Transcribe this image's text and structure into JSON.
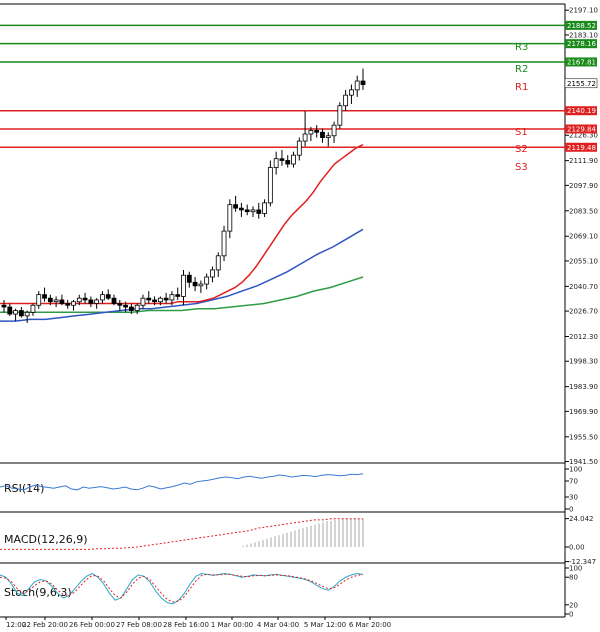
{
  "chart_data": {
    "type": "candlestick",
    "price_ticks": [
      2197.1,
      2183.1,
      2126.3,
      2111.9,
      2097.9,
      2083.5,
      2069.1,
      2055.1,
      2040.7,
      2026.7,
      2012.3,
      1998.3,
      1983.9,
      1969.9,
      1955.5,
      1941.5
    ],
    "price_range": [
      1941.5,
      2203.0
    ],
    "x_labels": [
      "12:00",
      "22 Feb 20:00",
      "26 Feb 00:00",
      "27 Feb 08:00",
      "28 Feb 16:00",
      "1 Mar 00:00",
      "4 Mar 04:00",
      "5 Mar 12:00",
      "6 Mar 20:00"
    ],
    "current_price": 2155.72,
    "levels": [
      {
        "name": "R3",
        "value": 2188.52,
        "value_label": "2188.52",
        "color": "#1a8a1a"
      },
      {
        "name": "",
        "value": 2178.16,
        "value_label": "2178.16",
        "color": "#1a8a1a"
      },
      {
        "name": "R2",
        "value": 2167.81,
        "value_label": "2167.81",
        "color": "#1a8a1a"
      },
      {
        "name": "R1",
        "value": 2140.19,
        "value_label": "2140.19",
        "color": "#e02020"
      },
      {
        "name": "S1",
        "value": 2129.84,
        "value_label": "2129.84",
        "color": "#e02020"
      },
      {
        "name": "S2",
        "value": 2119.48,
        "value_label": "2119.48",
        "color": "#e02020"
      },
      {
        "name": "S3",
        "value": null,
        "value_label": "",
        "color": "#e02020"
      }
    ],
    "candles": [
      [
        2030,
        2033,
        2026,
        2029
      ],
      [
        2029,
        2031,
        2024,
        2025
      ],
      [
        2025,
        2028,
        2021,
        2027
      ],
      [
        2027,
        2029,
        2023,
        2024
      ],
      [
        2024,
        2027,
        2020,
        2026
      ],
      [
        2026,
        2031,
        2024,
        2030
      ],
      [
        2030,
        2038,
        2028,
        2036
      ],
      [
        2036,
        2040,
        2032,
        2034
      ],
      [
        2034,
        2036,
        2030,
        2032
      ],
      [
        2032,
        2035,
        2029,
        2033
      ],
      [
        2033,
        2036,
        2030,
        2031
      ],
      [
        2031,
        2033,
        2028,
        2030
      ],
      [
        2030,
        2033,
        2027,
        2032
      ],
      [
        2032,
        2036,
        2030,
        2034
      ],
      [
        2034,
        2037,
        2031,
        2033
      ],
      [
        2033,
        2035,
        2029,
        2031
      ],
      [
        2031,
        2034,
        2028,
        2033
      ],
      [
        2033,
        2038,
        2031,
        2036
      ],
      [
        2036,
        2039,
        2033,
        2034
      ],
      [
        2034,
        2036,
        2030,
        2031
      ],
      [
        2031,
        2033,
        2027,
        2030
      ],
      [
        2030,
        2032,
        2026,
        2029
      ],
      [
        2029,
        2031,
        2025,
        2027
      ],
      [
        2027,
        2031,
        2025,
        2030
      ],
      [
        2030,
        2036,
        2028,
        2034
      ],
      [
        2034,
        2038,
        2031,
        2033
      ],
      [
        2033,
        2035,
        2030,
        2032
      ],
      [
        2032,
        2035,
        2030,
        2034
      ],
      [
        2034,
        2037,
        2031,
        2033
      ],
      [
        2033,
        2038,
        2030,
        2036
      ],
      [
        2036,
        2040,
        2033,
        2035
      ],
      [
        2035,
        2050,
        2030,
        2047
      ],
      [
        2047,
        2049,
        2040,
        2043
      ],
      [
        2043,
        2046,
        2038,
        2041
      ],
      [
        2041,
        2044,
        2037,
        2042
      ],
      [
        2042,
        2048,
        2039,
        2046
      ],
      [
        2046,
        2052,
        2043,
        2050
      ],
      [
        2050,
        2060,
        2046,
        2058
      ],
      [
        2058,
        2075,
        2055,
        2072
      ],
      [
        2072,
        2090,
        2068,
        2087
      ],
      [
        2087,
        2092,
        2083,
        2085
      ],
      [
        2085,
        2088,
        2080,
        2084
      ],
      [
        2084,
        2087,
        2081,
        2083
      ],
      [
        2083,
        2086,
        2080,
        2084
      ],
      [
        2084,
        2088,
        2079,
        2082
      ],
      [
        2082,
        2090,
        2080,
        2088
      ],
      [
        2088,
        2112,
        2086,
        2108
      ],
      [
        2108,
        2117,
        2104,
        2113
      ],
      [
        2113,
        2118,
        2109,
        2112
      ],
      [
        2112,
        2115,
        2108,
        2110
      ],
      [
        2110,
        2117,
        2108,
        2115
      ],
      [
        2115,
        2125,
        2112,
        2123
      ],
      [
        2123,
        2140,
        2120,
        2127
      ],
      [
        2127,
        2131,
        2123,
        2129
      ],
      [
        2129,
        2132,
        2125,
        2128
      ],
      [
        2128,
        2130,
        2122,
        2125
      ],
      [
        2125,
        2128,
        2120,
        2126
      ],
      [
        2126,
        2134,
        2122,
        2132
      ],
      [
        2132,
        2145,
        2130,
        2143
      ],
      [
        2143,
        2152,
        2140,
        2149
      ],
      [
        2149,
        2155,
        2144,
        2152
      ],
      [
        2152,
        2160,
        2148,
        2157
      ],
      [
        2157,
        2164,
        2152,
        2155
      ]
    ],
    "ma_red": [
      2031,
      2031,
      2031,
      2031,
      2031,
      2031,
      2031,
      2031,
      2031,
      2031,
      2031,
      2031,
      2031,
      2031,
      2031,
      2031,
      2031,
      2031,
      2031,
      2031,
      2031,
      2031,
      2031,
      2031,
      2031,
      2032,
      2032,
      2032,
      2032,
      2033,
      2034,
      2036,
      2038,
      2040,
      2043,
      2047,
      2052,
      2058,
      2064,
      2070,
      2076,
      2081,
      2085,
      2089,
      2094,
      2100,
      2105,
      2110,
      2113,
      2116,
      2119,
      2121
    ],
    "ma_blue": [
      2021,
      2021,
      2022,
      2022,
      2023,
      2024,
      2025,
      2026,
      2027,
      2028,
      2028,
      2029,
      2030,
      2031,
      2033,
      2035,
      2038,
      2041,
      2045,
      2049,
      2054,
      2059,
      2063,
      2068,
      2073
    ],
    "ma_green": [
      2026,
      2026,
      2026,
      2026,
      2026,
      2026,
      2026,
      2026,
      2026,
      2027,
      2027,
      2027,
      2028,
      2028,
      2029,
      2030,
      2031,
      2033,
      2035,
      2038,
      2040,
      2043,
      2046
    ],
    "rsi": {
      "label": "RSI(14)",
      "ticks": [
        100,
        70,
        30,
        0
      ],
      "values": [
        55,
        58,
        52,
        50,
        48,
        55,
        60,
        56,
        54,
        52,
        55,
        58,
        50,
        48,
        55,
        52,
        54,
        56,
        53,
        50,
        52,
        55,
        50,
        48,
        52,
        58,
        55,
        50,
        53,
        56,
        60,
        65,
        62,
        68,
        70,
        72,
        75,
        78,
        80,
        78,
        76,
        80,
        82,
        79,
        77,
        80,
        82,
        85,
        83,
        80,
        82,
        84,
        83,
        81,
        84,
        86,
        85,
        83,
        84,
        87,
        86,
        88
      ]
    },
    "macd": {
      "label": "MACD(12,26,9)",
      "ticks": [
        "24.042",
        "0.00",
        "-12.347"
      ],
      "histogram": [
        0,
        0,
        1,
        2,
        3,
        4,
        5,
        6,
        7,
        8,
        9,
        10,
        11,
        12,
        13,
        14,
        15,
        16,
        17,
        18,
        19,
        20,
        21,
        22,
        22,
        23,
        23,
        24,
        24,
        24,
        24,
        24,
        24
      ],
      "signal": [
        -2,
        -2,
        -2,
        -2,
        -2,
        -2,
        -2,
        -2,
        -2,
        -2,
        -2,
        -2,
        -1.5,
        -1.5,
        -1,
        -1,
        -0.5,
        0,
        1,
        2,
        3,
        4,
        5,
        6,
        7,
        8,
        9,
        10,
        11,
        12,
        13,
        14,
        16,
        17,
        18,
        19,
        20,
        21,
        22,
        23,
        23,
        24,
        24,
        24,
        24,
        24
      ]
    },
    "stoch": {
      "label": "Stoch(9,6,3)",
      "ticks": [
        100,
        80,
        20,
        0
      ],
      "k": [
        85,
        80,
        65,
        45,
        40,
        55,
        70,
        75,
        72,
        60,
        45,
        35,
        40,
        55,
        70,
        82,
        88,
        80,
        65,
        45,
        30,
        35,
        55,
        75,
        85,
        82,
        70,
        50,
        35,
        25,
        22,
        30,
        45,
        65,
        82,
        88,
        86,
        84,
        86,
        88,
        86,
        83,
        80,
        82,
        85,
        84,
        83,
        85,
        86,
        84,
        82,
        80,
        78,
        75,
        70,
        62,
        55,
        52,
        60,
        72,
        80,
        85,
        88,
        86
      ],
      "d": [
        80,
        78,
        70,
        55,
        45,
        50,
        62,
        70,
        72,
        65,
        52,
        42,
        40,
        48,
        62,
        75,
        84,
        82,
        72,
        55,
        40,
        35,
        48,
        65,
        78,
        82,
        75,
        60,
        45,
        32,
        26,
        28,
        38,
        55,
        72,
        84,
        86,
        85,
        85,
        86,
        86,
        84,
        82,
        81,
        83,
        84,
        83,
        84,
        85,
        84,
        83,
        81,
        79,
        76,
        72,
        66,
        60,
        55,
        57,
        65,
        74,
        80,
        84,
        86
      ]
    }
  }
}
